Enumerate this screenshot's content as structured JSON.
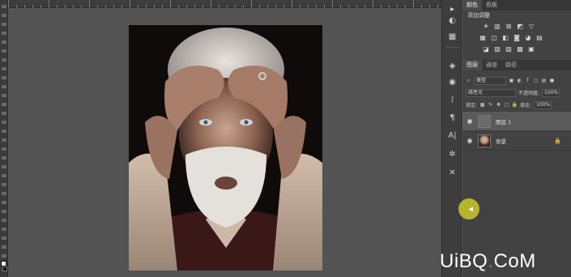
{
  "panels": {
    "adjustments": {
      "tabs": [
        "颜色",
        "色板"
      ],
      "title": "添加调整",
      "row1_icons": [
        "brightness-icon",
        "levels-icon",
        "curves-icon",
        "exposure-icon",
        "triangle-icon"
      ],
      "row2_icons": [
        "vibrance-icon",
        "hue-icon",
        "balance-icon",
        "bw-icon",
        "photo-filter-icon",
        "channel-mixer-icon"
      ],
      "row3_icons": [
        "invert-icon",
        "posterize-icon",
        "threshold-icon",
        "gradient-map-icon",
        "selective-color-icon"
      ]
    },
    "layers": {
      "tabs": [
        "图层",
        "通道",
        "路径"
      ],
      "filter_kind": "类型",
      "blend_mode": "线性光",
      "opacity_label": "不透明度:",
      "opacity_value": "100%",
      "lock_label": "锁定:",
      "fill_label": "填充:",
      "fill_value": "100%",
      "items": [
        {
          "name": "图层 1",
          "selected": true
        },
        {
          "name": "背景",
          "selected": false,
          "locked": true
        }
      ]
    }
  },
  "watermark": {
    "text_a": "UiBQ",
    "text_dot": ".",
    "text_b": "CoM"
  },
  "colors": {
    "cursor_highlight": "#d6d628",
    "watermark_dot": "#2fa0e0"
  }
}
